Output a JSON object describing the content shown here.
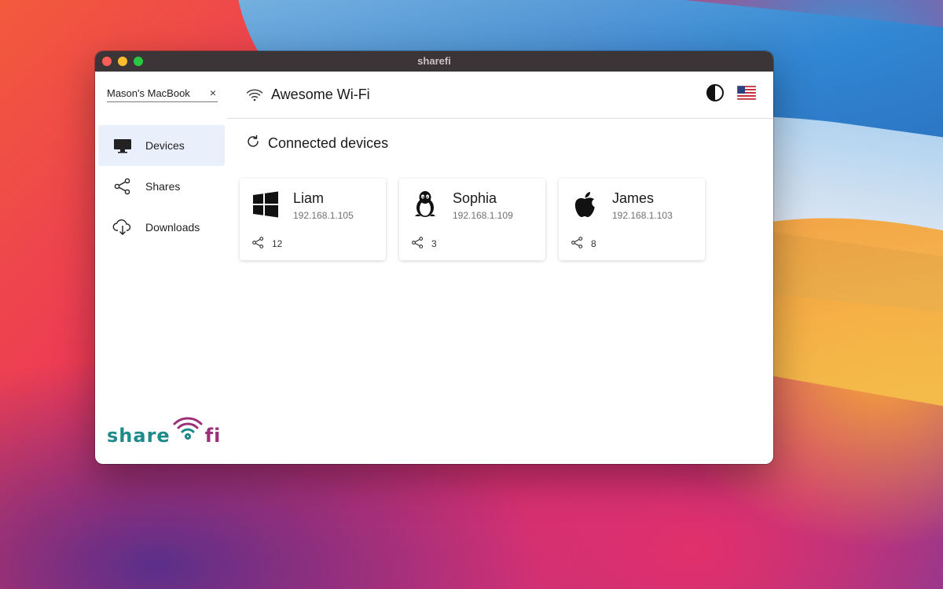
{
  "window": {
    "title": "sharefi"
  },
  "sidebar": {
    "device_name": "Mason's MacBook",
    "clear_symbol": "×",
    "items": [
      {
        "label": "Devices",
        "icon": "monitor-icon",
        "active": true
      },
      {
        "label": "Shares",
        "icon": "share-icon",
        "active": false
      },
      {
        "label": "Downloads",
        "icon": "cloud-download-icon",
        "active": false
      }
    ],
    "logo": {
      "part1": "share",
      "part2": "fi"
    }
  },
  "header": {
    "network_name": "Awesome Wi-Fi",
    "icons": [
      "wifi-icon",
      "theme-contrast-icon",
      "us-flag-icon"
    ]
  },
  "main": {
    "section_title": "Connected devices",
    "devices": [
      {
        "name": "Liam",
        "ip": "192.168.1.105",
        "shares": "12",
        "os": "windows"
      },
      {
        "name": "Sophia",
        "ip": "192.168.1.109",
        "shares": "3",
        "os": "linux"
      },
      {
        "name": "James",
        "ip": "192.168.1.103",
        "shares": "8",
        "os": "apple"
      }
    ]
  },
  "colors": {
    "active_nav_bg": "#eaf0fb",
    "logo_teal": "#1f8a8a",
    "logo_purple": "#9b2f7a",
    "titlebar": "#3b3537"
  }
}
